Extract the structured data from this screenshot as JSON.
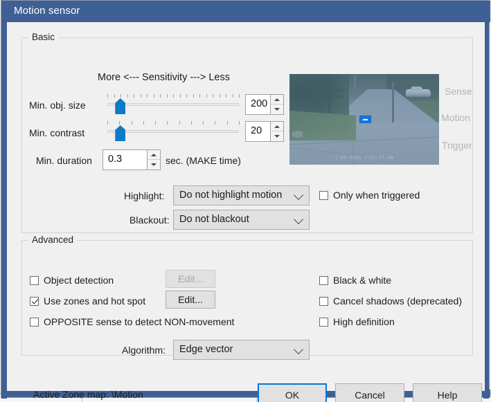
{
  "window": {
    "title": "Motion sensor"
  },
  "basic": {
    "legend": "Basic",
    "sensitivity_caption": "More <--- Sensitivity ---> Less",
    "min_obj_size": {
      "label": "Min. obj. size",
      "value": "200",
      "slider_percent": 7,
      "tick_count": 21
    },
    "min_contrast": {
      "label": "Min. contrast",
      "value": "20",
      "slider_percent": 7,
      "tick_count": 12
    },
    "min_duration": {
      "label": "Min. duration",
      "value": "0.3",
      "units_label": "sec.  (MAKE time)"
    },
    "highlight": {
      "label": "Highlight:",
      "value": "Do not highlight motion"
    },
    "blackout": {
      "label": "Blackout:",
      "value": "Do not blackout"
    },
    "only_when_triggered": {
      "label": "Only when triggered",
      "checked": false
    }
  },
  "preview": {
    "timestamp": "7-05-2023  7:52:37 AM",
    "indicators": {
      "sense": "Sense",
      "motion": "Motion",
      "trigger": "Trigger"
    }
  },
  "advanced": {
    "legend": "Advanced",
    "object_detection": {
      "label": "Object detection",
      "checked": false,
      "edit_label": "Edit...",
      "edit_enabled": false
    },
    "use_zones": {
      "label": "Use zones and hot spot",
      "checked": true,
      "edit_label": "Edit...",
      "edit_enabled": true
    },
    "opposite_sense": {
      "label": "OPPOSITE sense to detect NON-movement",
      "checked": false
    },
    "black_white": {
      "label": "Black & white",
      "checked": false
    },
    "cancel_shadows": {
      "label": "Cancel shadows (deprecated)",
      "checked": false
    },
    "high_definition": {
      "label": "High definition",
      "checked": false
    },
    "algorithm": {
      "label": "Algorithm:",
      "value": "Edge vector"
    }
  },
  "footer": {
    "active_zone_map": "Active Zone map:  \\Motion",
    "ok_label": "OK",
    "cancel_label": "Cancel",
    "help_label": "Help"
  },
  "colors": {
    "titlebar": "#3f6094",
    "accent": "#0078d7",
    "slider_thumb": "#0c7ac9",
    "dialog_bg": "#f0f0f0",
    "motion_box": "#1878d8"
  }
}
